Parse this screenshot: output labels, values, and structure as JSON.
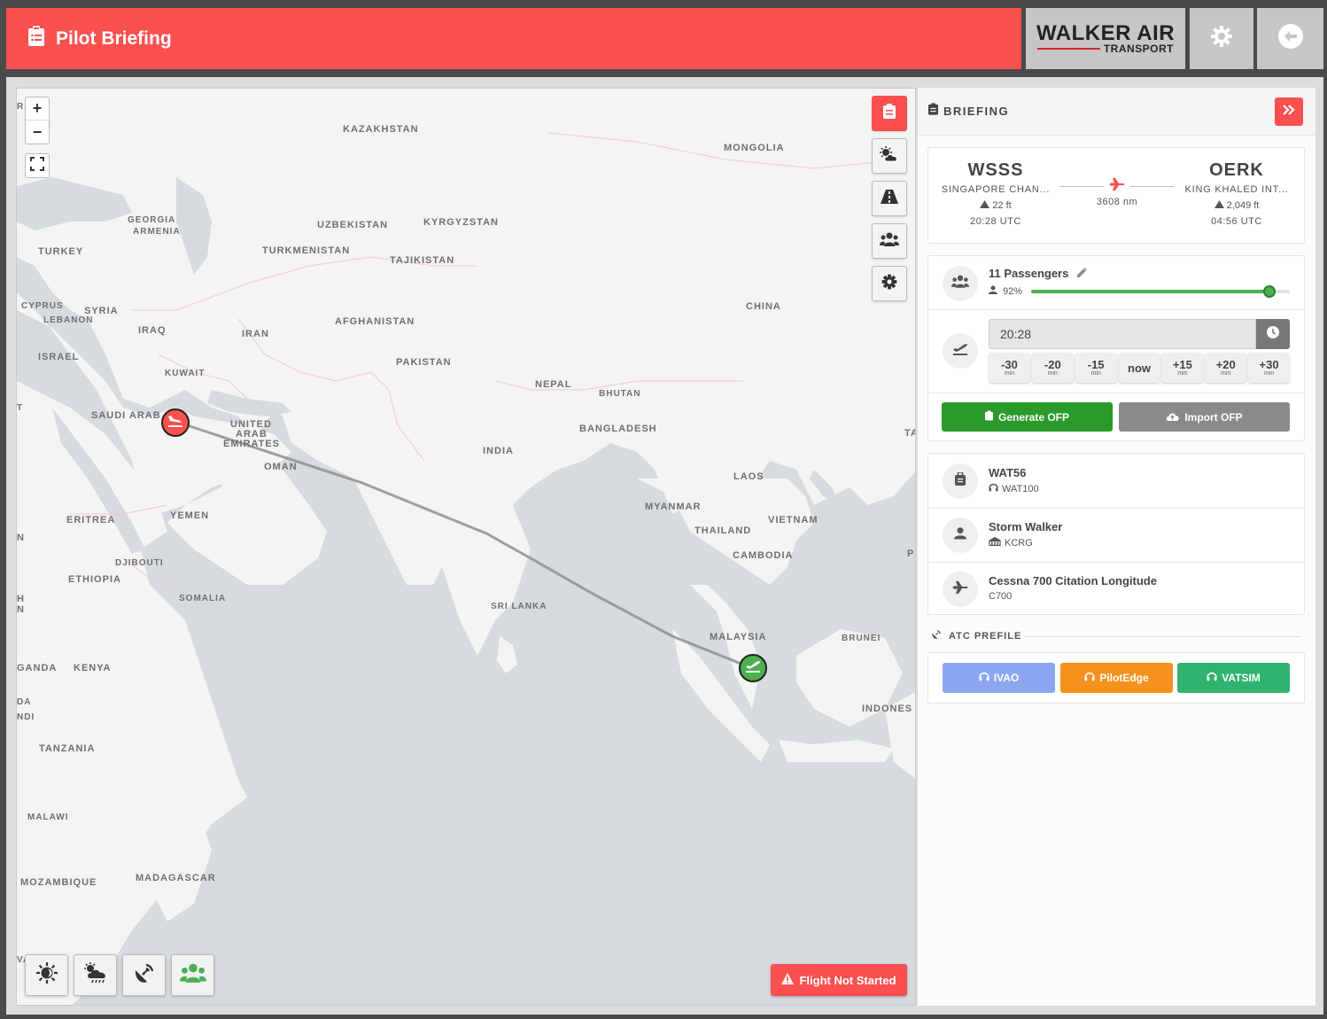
{
  "header": {
    "title": "Pilot Briefing",
    "logo_main": "WALKER AIR",
    "logo_sub": "TRANSPORT"
  },
  "map": {
    "labels": [
      {
        "id": "kazakhstan",
        "text": "KAZAKHSTAN"
      },
      {
        "id": "mongolia",
        "text": "MONGOLIA"
      },
      {
        "id": "georgia",
        "text": "GEORGIA"
      },
      {
        "id": "armenia",
        "text": "ARMENIA"
      },
      {
        "id": "uzbekistan",
        "text": "UZBEKISTAN"
      },
      {
        "id": "kyrgyzstan",
        "text": "KYRGYZSTAN"
      },
      {
        "id": "turkey",
        "text": "TURKEY"
      },
      {
        "id": "turkmenistan",
        "text": "TURKMENISTAN"
      },
      {
        "id": "tajikistan",
        "text": "TAJIKISTAN"
      },
      {
        "id": "cyprus",
        "text": "CYPRUS"
      },
      {
        "id": "syria",
        "text": "SYRIA"
      },
      {
        "id": "lebanon",
        "text": "LEBANON"
      },
      {
        "id": "afghanistan",
        "text": "AFGHANISTAN"
      },
      {
        "id": "china",
        "text": "CHINA"
      },
      {
        "id": "iraq",
        "text": "IRAQ"
      },
      {
        "id": "iran",
        "text": "IRAN"
      },
      {
        "id": "israel",
        "text": "ISRAEL"
      },
      {
        "id": "pakistan",
        "text": "PAKISTAN"
      },
      {
        "id": "kuwait",
        "text": "KUWAIT"
      },
      {
        "id": "nepal",
        "text": "NEPAL"
      },
      {
        "id": "bhutan",
        "text": "BHUTAN"
      },
      {
        "id": "saudi",
        "text": "SAUDI ARAB"
      },
      {
        "id": "uae1",
        "text": "UNITED"
      },
      {
        "id": "uae2",
        "text": "ARAB"
      },
      {
        "id": "uae3",
        "text": "EMIRATES"
      },
      {
        "id": "bangladesh",
        "text": "BANGLADESH"
      },
      {
        "id": "ta",
        "text": "TA"
      },
      {
        "id": "oman",
        "text": "OMAN"
      },
      {
        "id": "india",
        "text": "INDIA"
      },
      {
        "id": "laos",
        "text": "LAOS"
      },
      {
        "id": "myanmar",
        "text": "MYANMAR"
      },
      {
        "id": "eritrea",
        "text": "ERITREA"
      },
      {
        "id": "yemen",
        "text": "YEMEN"
      },
      {
        "id": "vietnam",
        "text": "VIETNAM"
      },
      {
        "id": "thailand",
        "text": "THAILAND"
      },
      {
        "id": "cambodia",
        "text": "CAMBODIA"
      },
      {
        "id": "p",
        "text": "P"
      },
      {
        "id": "djibouti",
        "text": "DJIBOUTI"
      },
      {
        "id": "ethiopia",
        "text": "ETHIOPIA"
      },
      {
        "id": "somalia",
        "text": "SOMALIA"
      },
      {
        "id": "n1",
        "text": "N"
      },
      {
        "id": "h",
        "text": "H"
      },
      {
        "id": "n2",
        "text": "N"
      },
      {
        "id": "srilanka",
        "text": "SRI LANKA"
      },
      {
        "id": "malaysia",
        "text": "MALAYSIA"
      },
      {
        "id": "brunei",
        "text": "BRUNEI"
      },
      {
        "id": "uganda",
        "text": "GANDA"
      },
      {
        "id": "kenya",
        "text": "KENYA"
      },
      {
        "id": "rwanda",
        "text": "DA"
      },
      {
        "id": "burundi",
        "text": "NDI"
      },
      {
        "id": "indonesia",
        "text": "INDONES"
      },
      {
        "id": "tanzania",
        "text": "TANZANIA"
      },
      {
        "id": "malawi",
        "text": "MALAWI"
      },
      {
        "id": "mozambique",
        "text": "MOZAMBIQUE"
      },
      {
        "id": "madagascar",
        "text": "MADAGASCAR"
      },
      {
        "id": "ra",
        "text": "RA"
      },
      {
        "id": "va",
        "text": "VA"
      },
      {
        "id": "t",
        "text": "T"
      }
    ],
    "status_label": "Flight Not Started"
  },
  "panel": {
    "title": "BRIEFING",
    "departure": {
      "code": "WSSS",
      "name": "SINGAPORE CHAN...",
      "elevation": "22 ft",
      "time": "20:28 UTC"
    },
    "arrival": {
      "code": "OERK",
      "name": "KING KHALED INT...",
      "elevation": "2,049 ft",
      "time": "04:56 UTC"
    },
    "distance": "3608 nm",
    "passengers": {
      "label": "11 Passengers",
      "load": "92%",
      "load_fraction": 0.92
    },
    "departure_time": "20:28",
    "offsets": [
      {
        "v": "-30",
        "u": "min"
      },
      {
        "v": "-20",
        "u": "min"
      },
      {
        "v": "-15",
        "u": "min"
      },
      {
        "v": "now",
        "u": ""
      },
      {
        "v": "+15",
        "u": "min"
      },
      {
        "v": "+20",
        "u": "min"
      },
      {
        "v": "+30",
        "u": "min"
      }
    ],
    "generate_ofp": "Generate OFP",
    "import_ofp": "Import OFP",
    "flight": {
      "callsign": "WAT56",
      "atc_callsign": "WAT100"
    },
    "pilot": {
      "name": "Storm Walker",
      "base": "KCRG"
    },
    "aircraft": {
      "name": "Cessna 700 Citation Longitude",
      "code": "C700"
    },
    "atc_title": "ATC PREFILE",
    "atc": [
      {
        "label": "IVAO",
        "color": "#8da6f2"
      },
      {
        "label": "PilotEdge",
        "color": "#f5921e"
      },
      {
        "label": "VATSIM",
        "color": "#2fb36f"
      }
    ]
  },
  "colors": {
    "accent": "#fc5050",
    "green": "#2a9a2a",
    "gray": "#8a8a8a"
  }
}
